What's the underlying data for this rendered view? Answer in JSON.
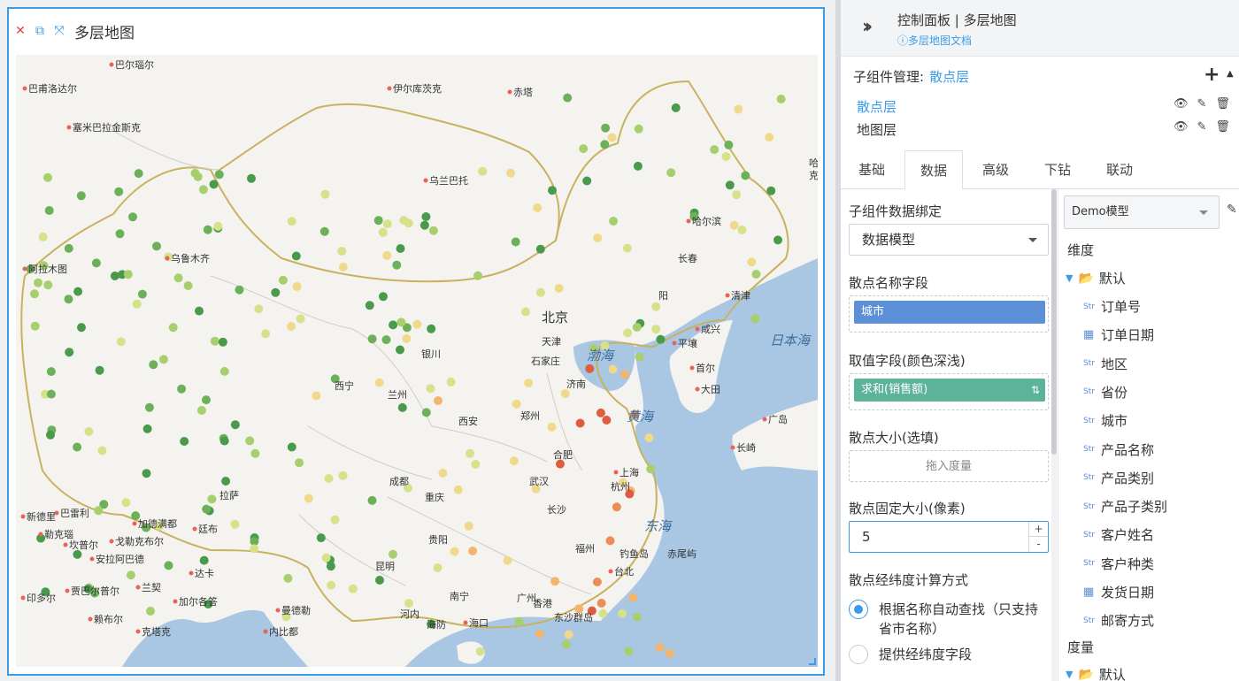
{
  "widget": {
    "title": "多层地图",
    "icons": {
      "close": "close-icon",
      "copy": "copy-icon",
      "fullscreen": "expand-icon"
    }
  },
  "map": {
    "background_colors": {
      "land": "#f4f3ef",
      "sea": "#a9c6e3",
      "border": "#c9b25f"
    },
    "labels": {
      "beijing": "北京",
      "tianjin": "天津",
      "shijiazhuang": "石家庄",
      "jinan": "济南",
      "harbin": "哈尔滨",
      "changchun": "长春",
      "shenyang": "阳",
      "wulumuqi": "乌鲁木齐",
      "wulanbatuo": "乌兰巴托",
      "yinchuan": "银川",
      "lanzhou": "兰州",
      "xining": "西宁",
      "xian": "西安",
      "zhengzhou": "郑州",
      "hefei": "合肥",
      "shanghai": "上海",
      "hangzhou": "杭州",
      "wuhan": "武汉",
      "chengdu": "成都",
      "chongqing": "重庆",
      "changsha": "长沙",
      "guiyang": "贵阳",
      "kunming": "昆明",
      "nanning": "南宁",
      "guangzhou": "广州",
      "hongkong": "香港",
      "fuzhou": "福州",
      "taipei": "台北",
      "lasa": "拉萨",
      "haikou": "海口",
      "hanoi": "河内",
      "hefang": "海防",
      "dongsha": "东沙群岛",
      "diaoyu": "钓鱼岛",
      "chiwei": "赤尾屿",
      "pyongyang": "平壤",
      "seoul": "首尔",
      "daejeon": "大田",
      "qingjin": "清津",
      "xianxing": "咸兴",
      "busan": "广岛",
      "nagasaki": "长崎",
      "barnaul": "巴尔瑙尔",
      "pavlodar": "巴甫洛达尔",
      "semey": "塞米巴拉金斯克",
      "irkutsk": "伊尔库茨克",
      "chita": "赤塔",
      "almaty": "阿拉木图",
      "delhi": "新德里",
      "bareilly": "巴雷利",
      "kathmandu": "加德满都",
      "thimphu": "廷布",
      "lucknow": "勒克瑙",
      "kanpur": "坎普尔",
      "gorakhpur": "戈勒克布尔",
      "allahabad": "安拉阿巴德",
      "dhaka": "达卡",
      "ranchi": "兰契",
      "indore": "印多尔",
      "kolkata": "加尔各答",
      "jabalpur": "贾巴尔普尔",
      "raipur": "赖布尔",
      "mandalay": "曼德勒",
      "naypyidaw": "内比都",
      "cuttack": "克塔克",
      "bohai": "渤海",
      "huanghai": "黄海",
      "donghai": "东海",
      "japansea": "日本海",
      "ha": "哈",
      "hei": "克"
    }
  },
  "panel": {
    "title": "控制面板 | 多层地图",
    "doc_link": "多层地图文档",
    "sub_label": "子组件管理:",
    "sub_current": "散点层",
    "layers": [
      "散点层",
      "地图层"
    ],
    "tabs": [
      "基础",
      "数据",
      "高级",
      "下钻",
      "联动"
    ],
    "active_tab": "数据",
    "form": {
      "binding_label": "子组件数据绑定",
      "binding_value": "数据模型",
      "name_field_label": "散点名称字段",
      "name_field_chip": "城市",
      "value_field_label": "取值字段(颜色深浅)",
      "value_field_chip": "求和(销售额)",
      "size_label": "散点大小(选填)",
      "size_placeholder": "拖入度量",
      "fixed_size_label": "散点固定大小(像素)",
      "fixed_size_value": "5",
      "latlng_label": "散点经纬度计算方式",
      "radio_auto": "根据名称自动查找（只支持省市名称）",
      "radio_manual": "提供经纬度字段"
    },
    "model": "Demo模型",
    "dimension_title": "维度",
    "measure_title": "度量",
    "default_folder": "默认",
    "dimensions": [
      {
        "type": "Str",
        "name": "订单号"
      },
      {
        "type": "date",
        "name": "订单日期"
      },
      {
        "type": "Str",
        "name": "地区"
      },
      {
        "type": "Str",
        "name": "省份"
      },
      {
        "type": "Str",
        "name": "城市"
      },
      {
        "type": "Str",
        "name": "产品名称"
      },
      {
        "type": "Str",
        "name": "产品类别"
      },
      {
        "type": "Str",
        "name": "产品子类别"
      },
      {
        "type": "Str",
        "name": "客户姓名"
      },
      {
        "type": "Str",
        "name": "客户种类"
      },
      {
        "type": "date",
        "name": "发货日期"
      },
      {
        "type": "Str",
        "name": "邮寄方式"
      }
    ]
  }
}
